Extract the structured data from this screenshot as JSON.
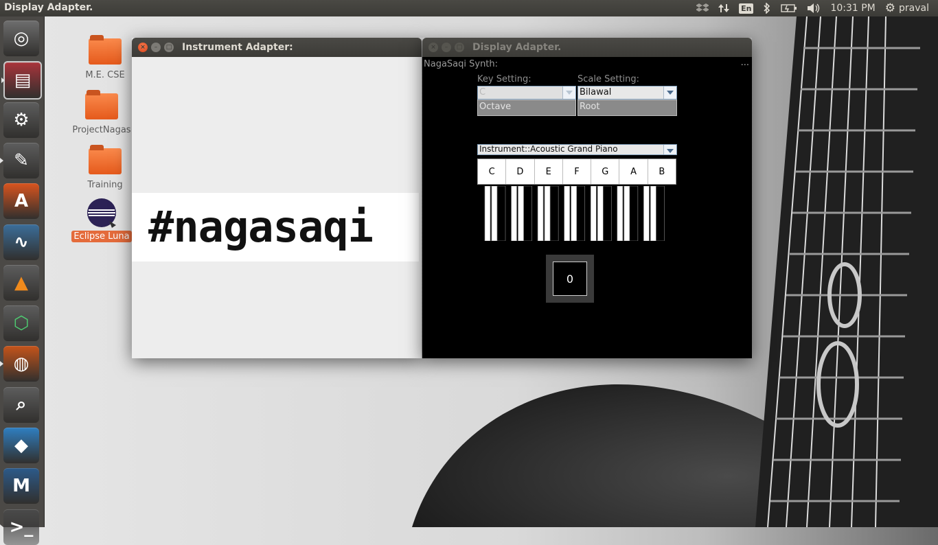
{
  "top_panel": {
    "app_title": "Display Adapter.",
    "keyboard_layout": "En",
    "clock": "10:31 PM",
    "user": "praval"
  },
  "launcher": {
    "items": [
      {
        "name": "dash-home",
        "icon": "ubuntu-logo-icon",
        "color": "#6e6e6e"
      },
      {
        "name": "files",
        "icon": "file-cabinet-icon",
        "color": "#a8343b"
      },
      {
        "name": "system-settings",
        "icon": "gear-wrench-icon",
        "color": "#5d5d5d"
      },
      {
        "name": "text-editor",
        "icon": "notepad-icon",
        "color": "#5d5d5d"
      },
      {
        "name": "software-center",
        "icon": "shopping-bag-icon",
        "color": "#d9541e"
      },
      {
        "name": "system-monitor",
        "icon": "monitor-graph-icon",
        "color": "#3b6e9a"
      },
      {
        "name": "vlc",
        "icon": "traffic-cone-icon",
        "color": "#5d5d5d"
      },
      {
        "name": "app-hexagon",
        "icon": "green-hexagon-icon",
        "color": "#5d5d5d"
      },
      {
        "name": "firefox",
        "icon": "firefox-icon",
        "color": "#c5541a"
      },
      {
        "name": "image-viewer",
        "icon": "magnifier-chart-icon",
        "color": "#5d5d5d"
      },
      {
        "name": "dropbox",
        "icon": "dropbox-icon",
        "color": "#2f7fc1"
      },
      {
        "name": "app-m",
        "icon": "m-logo-icon",
        "color": "#2c5a8a"
      },
      {
        "name": "terminal",
        "icon": "terminal-icon",
        "color": "#4a4a4a"
      }
    ]
  },
  "desktop": {
    "icons": [
      {
        "label": "M.E. CSE"
      },
      {
        "label": "ProjectNagas"
      },
      {
        "label": "Training"
      },
      {
        "label": "Eclipse Luna"
      }
    ]
  },
  "instrument_window": {
    "title": "Instrument Adapter:",
    "banner_text": "#nagasaqi"
  },
  "display_window": {
    "title": "Display Adapter.",
    "synth_label": "NagaSaqi Synth:",
    "overflow_indicator": "...",
    "key_setting_label": "Key Setting:",
    "key_value": "C",
    "scale_setting_label": "Scale Setting:",
    "scale_value": "Bilawal",
    "octave_field": "Octave",
    "root_field": "Root",
    "instrument_value": "Instrument::Acoustic Grand Piano",
    "notes": [
      "C",
      "D",
      "E",
      "F",
      "G",
      "A",
      "B"
    ],
    "counter_value": "0"
  }
}
